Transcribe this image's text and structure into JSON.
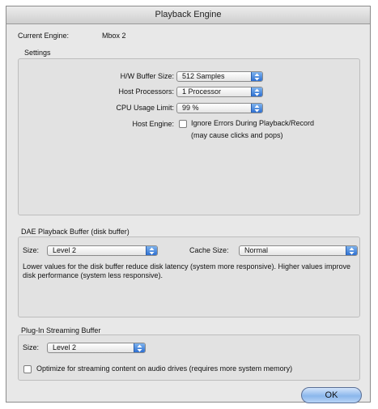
{
  "window": {
    "title": "Playback Engine"
  },
  "engine": {
    "label": "Current Engine:",
    "value": "Mbox 2"
  },
  "settings": {
    "heading": "Settings",
    "buffer_label": "H/W Buffer Size:",
    "buffer_value": "512 Samples",
    "processors_label": "Host Processors:",
    "processors_value": "1 Processor",
    "cpu_label": "CPU Usage Limit:",
    "cpu_value": "99 %",
    "host_engine_label": "Host Engine:",
    "ignore_errors_label": "Ignore Errors During Playback/Record",
    "ignore_errors_note": "(may cause clicks and pops)"
  },
  "dae": {
    "heading": "DAE Playback Buffer (disk buffer)",
    "size_label": "Size:",
    "size_value": "Level 2",
    "cache_label": "Cache Size:",
    "cache_value": "Normal",
    "description": "Lower values for the disk buffer reduce disk latency (system more responsive).  Higher values improve disk performance (system less responsive)."
  },
  "plugin": {
    "heading": "Plug-In Streaming Buffer",
    "size_label": "Size:",
    "size_value": "Level 2",
    "optimize_label": "Optimize for streaming content on audio drives (requires more system memory)"
  },
  "buttons": {
    "ok": "OK"
  },
  "colors": {
    "accent": "#3d7fd9",
    "window_bg": "#e8e8e8"
  }
}
